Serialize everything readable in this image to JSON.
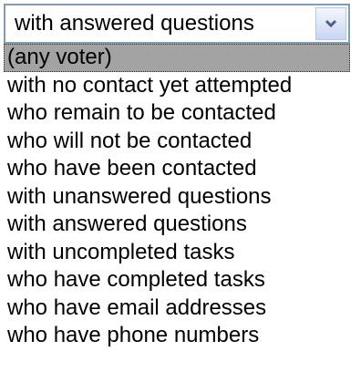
{
  "select": {
    "value": "with answered questions",
    "arrow_icon": "chevron-down-icon"
  },
  "options": [
    {
      "label": "(any voter)",
      "highlighted": true
    },
    {
      "label": "with no contact yet attempted"
    },
    {
      "label": "who remain to be contacted"
    },
    {
      "label": "who will not be contacted"
    },
    {
      "label": "who have been contacted"
    },
    {
      "label": "with unanswered questions"
    },
    {
      "label": "with answered questions"
    },
    {
      "label": "with uncompleted tasks"
    },
    {
      "label": "who have completed tasks"
    },
    {
      "label": "who have email addresses"
    },
    {
      "label": "who have phone numbers"
    }
  ],
  "colors": {
    "highlight": "#a3a3a3",
    "border": "#7f9db9"
  }
}
